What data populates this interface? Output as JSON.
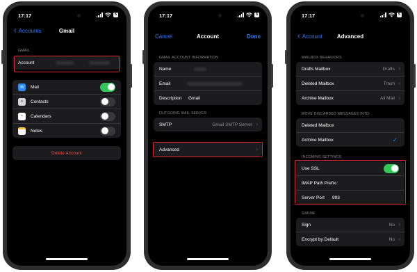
{
  "status_time": "17:17",
  "battery": "5",
  "phone1": {
    "nav": {
      "back": "Accounts",
      "title": "Gmail"
    },
    "section_label": "GMAIL",
    "account_label": "Account",
    "apps": [
      {
        "label": "Mail",
        "toggle": "on"
      },
      {
        "label": "Contacts",
        "toggle": "off"
      },
      {
        "label": "Calendars",
        "toggle": "off"
      },
      {
        "label": "Notes",
        "toggle": "off"
      }
    ],
    "delete_label": "Delete Account"
  },
  "phone2": {
    "nav": {
      "left": "Cancel",
      "title": "Account",
      "right": "Done"
    },
    "section_info": "GMAIL ACCOUNT INFORMATION",
    "info_rows": [
      {
        "label": "Name",
        "value": ""
      },
      {
        "label": "Email",
        "value": ""
      },
      {
        "label": "Description",
        "value": "Gmail"
      }
    ],
    "section_smtp": "OUTGOING MAIL SERVER",
    "smtp": {
      "label": "SMTP",
      "value": "Gmail SMTP Server"
    },
    "advanced_label": "Advanced"
  },
  "phone3": {
    "nav": {
      "back": "Account",
      "title": "Advanced"
    },
    "section_mailbox": "MAILBOX BEHAVIORS",
    "mailbox_rows": [
      {
        "label": "Drafts Mailbox",
        "value": "Drafts"
      },
      {
        "label": "Deleted Mailbox",
        "value": "Trash"
      },
      {
        "label": "Archive Mailbox",
        "value": "All Mail"
      }
    ],
    "section_move": "MOVE DISCARDED MESSAGES INTO:",
    "move_rows": [
      {
        "label": "Deleted Mailbox",
        "checked": false
      },
      {
        "label": "Archive Mailbox",
        "checked": true
      }
    ],
    "section_incoming": "INCOMING SETTINGS",
    "incoming": {
      "ssl_label": "Use SSL",
      "ssl": "on",
      "imap_label": "IMAP Path Prefix",
      "imap_value": "/",
      "port_label": "Server Port",
      "port_value": "993"
    },
    "section_smime": "S/MIME",
    "smime_rows": [
      {
        "label": "Sign",
        "value": "No"
      },
      {
        "label": "Encrypt by Default",
        "value": "No"
      }
    ]
  },
  "colors": {
    "accent": "#2f7cf6",
    "toggle_on": "#34c759",
    "highlight": "#e0262f",
    "destructive": "#ff453a"
  }
}
